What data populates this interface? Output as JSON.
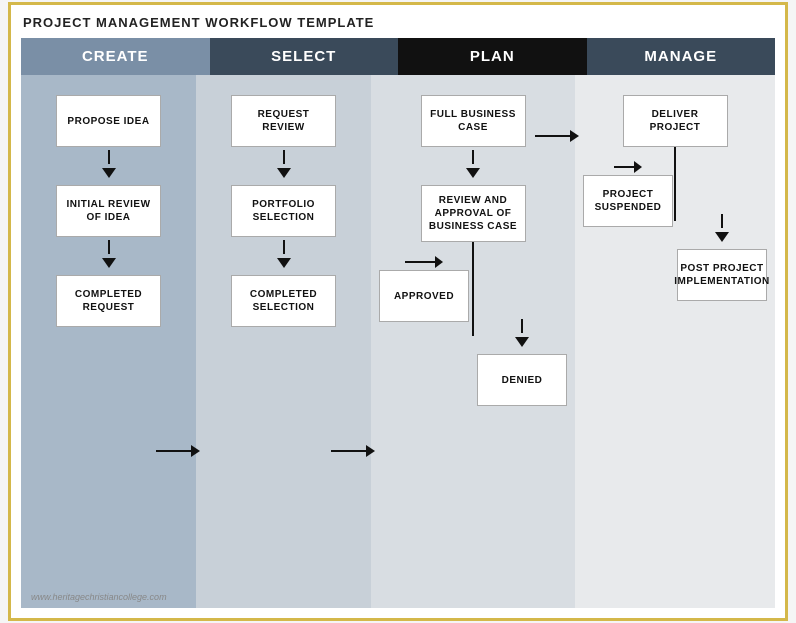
{
  "page": {
    "title": "PROJECT MANAGEMENT WORKFLOW TEMPLATE",
    "watermark": "www.heritagechristiancollege.com"
  },
  "headers": {
    "create": "CREATE",
    "select": "SELECT",
    "plan": "PLAN",
    "manage": "MANAGE"
  },
  "create_column": {
    "box1": "PROPOSE IDEA",
    "box2": "INITIAL REVIEW OF IDEA",
    "box3": "COMPLETED REQUEST"
  },
  "select_column": {
    "box1": "REQUEST REVIEW",
    "box2": "PORTFOLIO SELECTION",
    "box3": "COMPLETED SELECTION"
  },
  "plan_column": {
    "box1": "FULL BUSINESS CASE",
    "box2": "REVIEW AND APPROVAL OF BUSINESS CASE",
    "box3": "APPROVED",
    "box4": "DENIED"
  },
  "manage_column": {
    "box1": "DELIVER PROJECT",
    "box2": "PROJECT SUSPENDED",
    "box3": "POST PROJECT IMPLEMENTATION"
  }
}
